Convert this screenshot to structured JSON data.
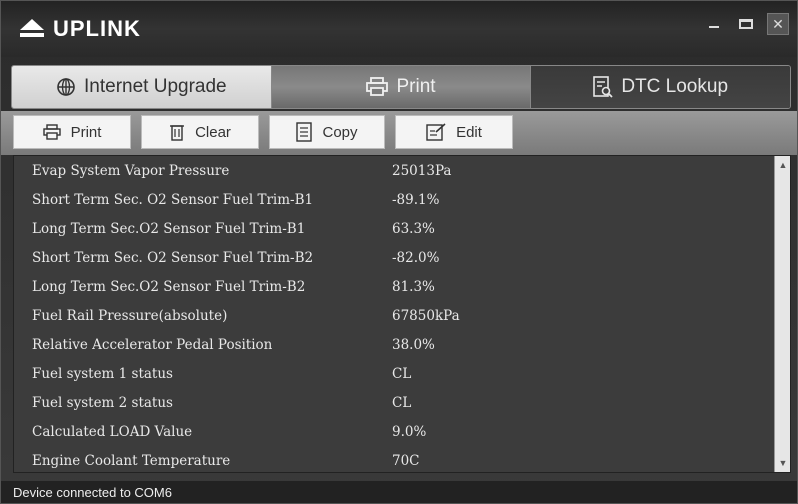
{
  "app": {
    "title": "UPLINK"
  },
  "tabs": [
    {
      "label": "Internet Upgrade",
      "icon": "globe-icon"
    },
    {
      "label": "Print",
      "icon": "printer-icon",
      "active": true
    },
    {
      "label": "DTC Lookup",
      "icon": "document-search-icon"
    }
  ],
  "toolbar": {
    "print_label": "Print",
    "clear_label": "Clear",
    "copy_label": "Copy",
    "edit_label": "Edit"
  },
  "rows": [
    {
      "name": "Evap System Vapor Pressure",
      "value": "25013Pa"
    },
    {
      "name": "Short Term Sec. O2 Sensor Fuel Trim-B1",
      "value": "-89.1%"
    },
    {
      "name": "Long Term Sec.O2 Sensor Fuel Trim-B1",
      "value": "63.3%"
    },
    {
      "name": "Short Term Sec. O2 Sensor Fuel Trim-B2",
      "value": "-82.0%"
    },
    {
      "name": "Long Term Sec.O2 Sensor Fuel Trim-B2",
      "value": "81.3%"
    },
    {
      "name": "Fuel Rail Pressure(absolute)",
      "value": "67850kPa"
    },
    {
      "name": "Relative Accelerator Pedal Position",
      "value": "38.0%"
    },
    {
      "name": "Fuel system 1 status",
      "value": "CL"
    },
    {
      "name": "Fuel system 2 status",
      "value": "CL"
    },
    {
      "name": "Calculated LOAD Value",
      "value": "9.0%"
    },
    {
      "name": "Engine Coolant Temperature",
      "value": "70C"
    }
  ],
  "status": {
    "text": "Device connected to COM6"
  }
}
